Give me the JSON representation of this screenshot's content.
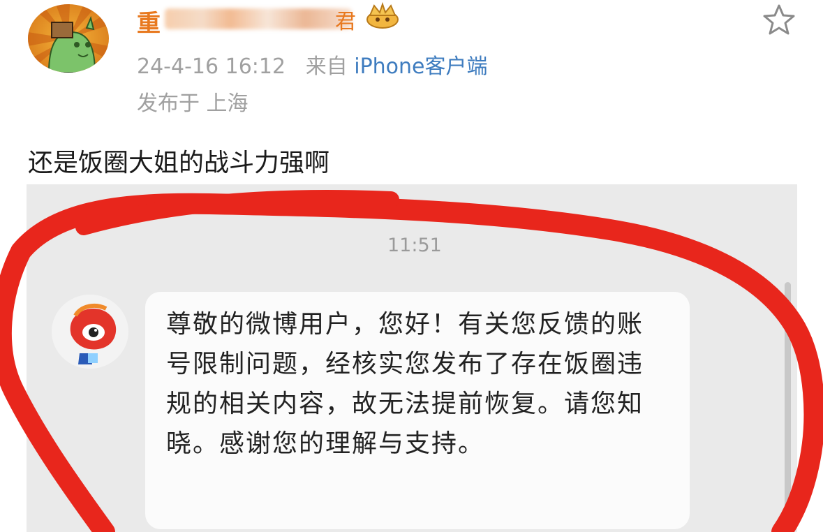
{
  "post": {
    "username_visible": "重",
    "name_tail": "君",
    "datetime": "24-4-16 16:12",
    "from_label": "来自",
    "source": "iPhone客户端",
    "location": "发布于 上海",
    "text": "还是饭圈大姐的战斗力强啊"
  },
  "chat": {
    "time": "11:51",
    "message": "尊敬的微博用户，您好！有关您反馈的账号限制问题，经核实您发布了存在饭圈违规的相关内容，故无法提前恢复。请您知晓。感谢您的理解与支持。"
  },
  "icons": {
    "favorite": "star-outline-icon",
    "badge": "crown-badge-icon"
  },
  "colors": {
    "username": "#e8791f",
    "source_link": "#3e7cbf",
    "annotation_red": "#e8261c"
  }
}
